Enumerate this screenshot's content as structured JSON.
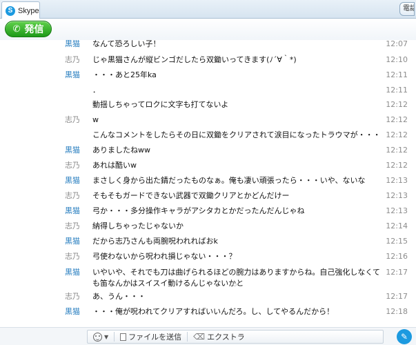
{
  "tabs": [
    {
      "label": "Skype"
    }
  ],
  "right_tab": {
    "label": "電話"
  },
  "call_button": {
    "label": "発信"
  },
  "icons": {
    "skype": "skype-logo-icon",
    "phone": "phone-icon",
    "emoji": "emoji-icon",
    "file": "file-icon",
    "extras": "extras-icon",
    "send": "chat-send-icon"
  },
  "colors": {
    "kuroneko": "#2a7fc0",
    "shino": "#8a8a8a",
    "call_green": "#2aa61f",
    "skype_blue": "#1c9ae0"
  },
  "messages": [
    {
      "sender": "黒猫",
      "text": "なんて恐ろしい子！",
      "time": "12:07"
    },
    {
      "sender": "志乃",
      "text": "じゃ黒猫さんが縦ビンゴだしたら双鋤いってきます(ﾉ´∀｀*)",
      "time": "12:10"
    },
    {
      "sender": "黒猫",
      "text": "・・・あと25年ka",
      "time": "12:11"
    },
    {
      "sender": "",
      "text": "．",
      "time": "12:11"
    },
    {
      "sender": "",
      "text": "動揺しちゃってロクに文字も打てないよ",
      "time": "12:12"
    },
    {
      "sender": "志乃",
      "text": "w",
      "time": "12:12"
    },
    {
      "sender": "",
      "text": "こんなコメントをしたらその日に双鋤をクリアされて涙目になったトラウマが・・・",
      "time": "12:12"
    },
    {
      "sender": "黒猫",
      "text": "ありましたねww",
      "time": "12:12"
    },
    {
      "sender": "志乃",
      "text": "あれは酷いw",
      "time": "12:12"
    },
    {
      "sender": "黒猫",
      "text": "まさしく身から出た錆だったものなぁ。俺も凄い頑張ったら・・・いや、ないな",
      "time": "12:13"
    },
    {
      "sender": "志乃",
      "text": "そもそもガードできない武器で双鋤クリアとかどんだけー",
      "time": "12:13"
    },
    {
      "sender": "黒猫",
      "text": "弓か・・・多分操作キャラがアシタカとかだったんだんじゃね",
      "time": "12:13"
    },
    {
      "sender": "志乃",
      "text": "納得しちゃったじゃないか",
      "time": "12:14"
    },
    {
      "sender": "黒猫",
      "text": "だから志乃さんも両腕呪われればおk",
      "time": "12:15"
    },
    {
      "sender": "志乃",
      "text": "弓使わないから呪われ損じゃない・・・？",
      "time": "12:16"
    },
    {
      "sender": "黒猫",
      "text": "いやいや、それでも刀は曲げられるほどの腕力はありますからね。自己強化しなくても笛なんかはスイスイ動けるんじゃないかと",
      "time": "12:17"
    },
    {
      "sender": "志乃",
      "text": "あ、うん・・・",
      "time": "12:17"
    },
    {
      "sender": "黒猫",
      "text": "・・・俺が呪われてクリアすればいいんだろ。し、してやるんだから！",
      "time": "12:18"
    }
  ],
  "toolbar": {
    "send_file": "ファイルを送信",
    "extras": "エクストラ"
  }
}
